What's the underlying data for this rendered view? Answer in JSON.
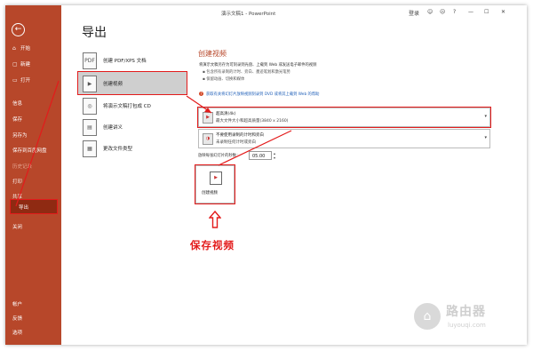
{
  "window": {
    "title": "演示文稿1 - PowerPoint",
    "user": "登录",
    "controls": [
      "☺",
      "☹",
      "?",
      "—",
      "☐",
      "✕"
    ]
  },
  "sidebar": {
    "back_icon": "back-arrow-icon",
    "items": [
      {
        "label": "开始",
        "icon": "⌂"
      },
      {
        "label": "新建",
        "icon": "▢"
      },
      {
        "label": "打开",
        "icon": "▭"
      },
      {
        "label": "信息",
        "icon": ""
      },
      {
        "label": "保存",
        "icon": ""
      },
      {
        "label": "另存为",
        "icon": ""
      },
      {
        "label": "保存到百度网盘",
        "icon": ""
      },
      {
        "label": "历史记录",
        "icon": ""
      },
      {
        "label": "打印",
        "icon": ""
      },
      {
        "label": "共享",
        "icon": ""
      },
      {
        "label": "导出",
        "icon": ""
      },
      {
        "label": "关闭",
        "icon": ""
      }
    ],
    "bottom": [
      "帐户",
      "反馈",
      "选项"
    ]
  },
  "page": {
    "heading": "导出"
  },
  "export_options": [
    {
      "label": "创建 PDF/XPS 文档",
      "icon": "PDF"
    },
    {
      "label": "创建视频",
      "icon": "▶"
    },
    {
      "label": "将演示文稿打包成 CD",
      "icon": "◎"
    },
    {
      "label": "创建讲义",
      "icon": "▤"
    },
    {
      "label": "更改文件类型",
      "icon": "▦"
    }
  ],
  "video_panel": {
    "title": "创建视频",
    "desc": "将演示文稿另存为可刻录到光盘、上载到 Web 或发送电子邮件的视频",
    "bullets": [
      "包含所有录制的计时、旁白、墨迹笔划和激光笔势",
      "保留动画、切换和媒体"
    ],
    "help_link": "获取有关将幻灯片放映视频刻录到 DVD 或将其上载到 Web 的帮助",
    "quality": {
      "line1": "超高清(4k)",
      "line2": "最大文件大小和超高质量(3840 x 2160)"
    },
    "timing": {
      "line1": "不要使用录制的计时和旁白",
      "line2": "未录制任何计时或旁白"
    },
    "seconds_label": "放映每张幻灯片的秒数：",
    "seconds_value": "05.00",
    "create_button": "创建视频"
  },
  "annotation": "保存视频",
  "watermark": {
    "title": "路由器",
    "url": "luyouqi.com"
  },
  "colors": {
    "accent": "#b7472a",
    "highlight": "#e31b1b"
  }
}
